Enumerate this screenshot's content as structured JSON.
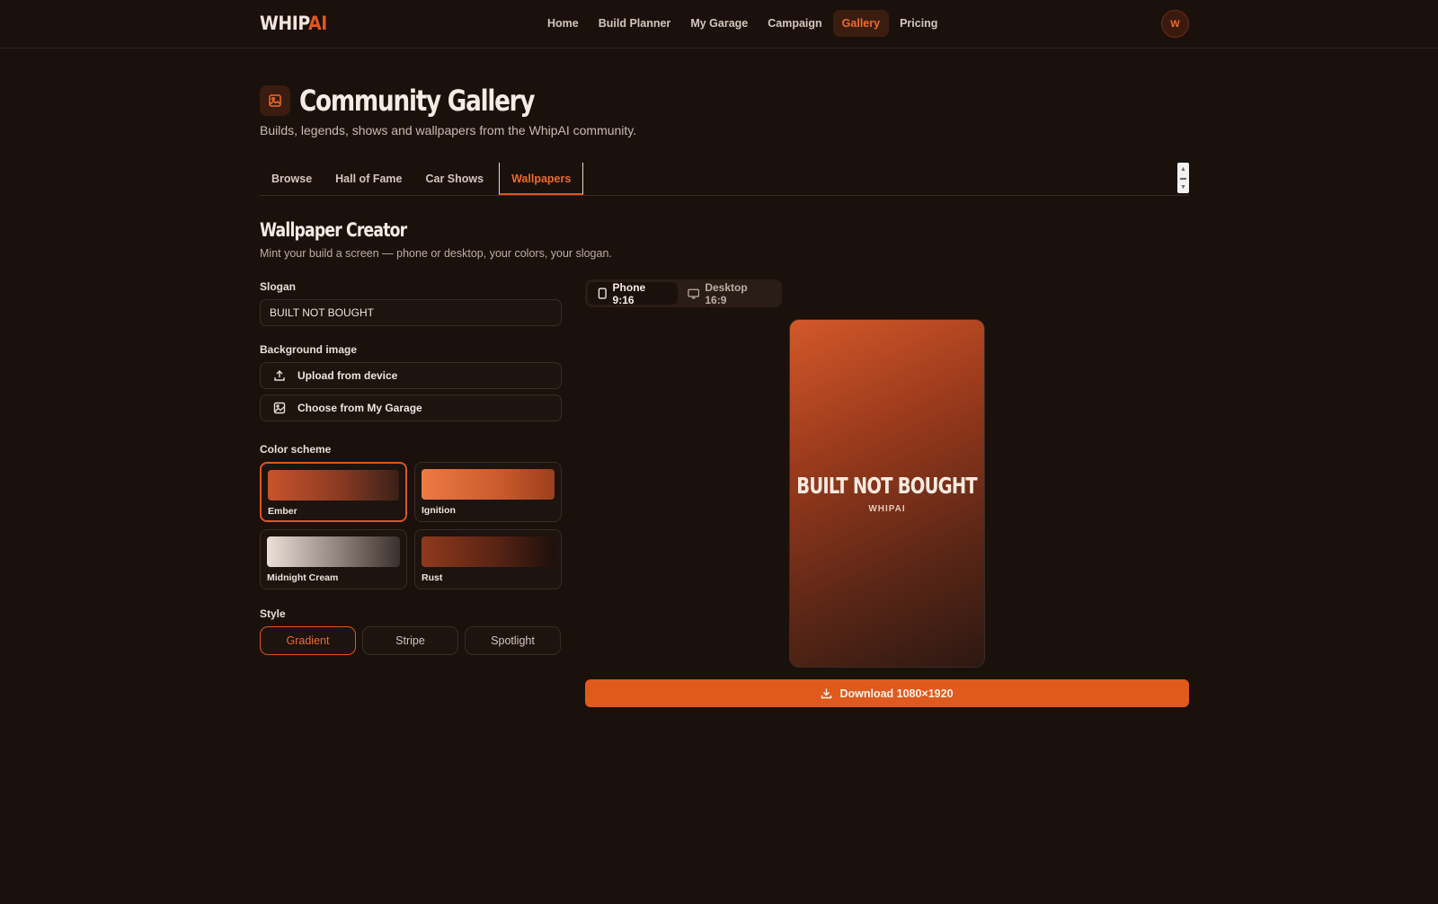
{
  "brand": {
    "prefix": "WHIP",
    "suffix": "AI"
  },
  "nav": {
    "items": [
      {
        "label": "Home"
      },
      {
        "label": "Build Planner"
      },
      {
        "label": "My Garage"
      },
      {
        "label": "Campaign"
      },
      {
        "label": "Gallery",
        "active": true
      },
      {
        "label": "Pricing"
      }
    ]
  },
  "user": {
    "avatar_initial": "W"
  },
  "page": {
    "title": "Community Gallery",
    "subtitle": "Builds, legends, shows and wallpapers from the WhipAI community."
  },
  "tabs": [
    {
      "label": "Browse"
    },
    {
      "label": "Hall of Fame"
    },
    {
      "label": "Car Shows"
    },
    {
      "label": "Wallpapers",
      "active": true
    }
  ],
  "creator": {
    "title": "Wallpaper Creator",
    "subtitle": "Mint your build a screen — phone or desktop, your colors, your slogan.",
    "slogan_label": "Slogan",
    "slogan_value": "BUILT NOT BOUGHT",
    "background_label": "Background image",
    "upload_label": "Upload from device",
    "garage_label": "Choose from My Garage",
    "color_label": "Color scheme",
    "schemes": [
      {
        "name": "Ember",
        "active": true
      },
      {
        "name": "Ignition"
      },
      {
        "name": "Midnight Cream"
      },
      {
        "name": "Rust"
      }
    ],
    "style_label": "Style",
    "styles": [
      {
        "label": "Gradient",
        "active": true
      },
      {
        "label": "Stripe"
      },
      {
        "label": "Spotlight"
      }
    ]
  },
  "preview": {
    "ratio_phone": "Phone 9:16",
    "ratio_desktop": "Desktop 16:9",
    "slogan": "BUILT NOT BOUGHT",
    "brand": "WHIPAI",
    "download_label": "Download 1080×1920"
  },
  "colors": {
    "accent": "#e0551f",
    "background": "#1a100c"
  }
}
